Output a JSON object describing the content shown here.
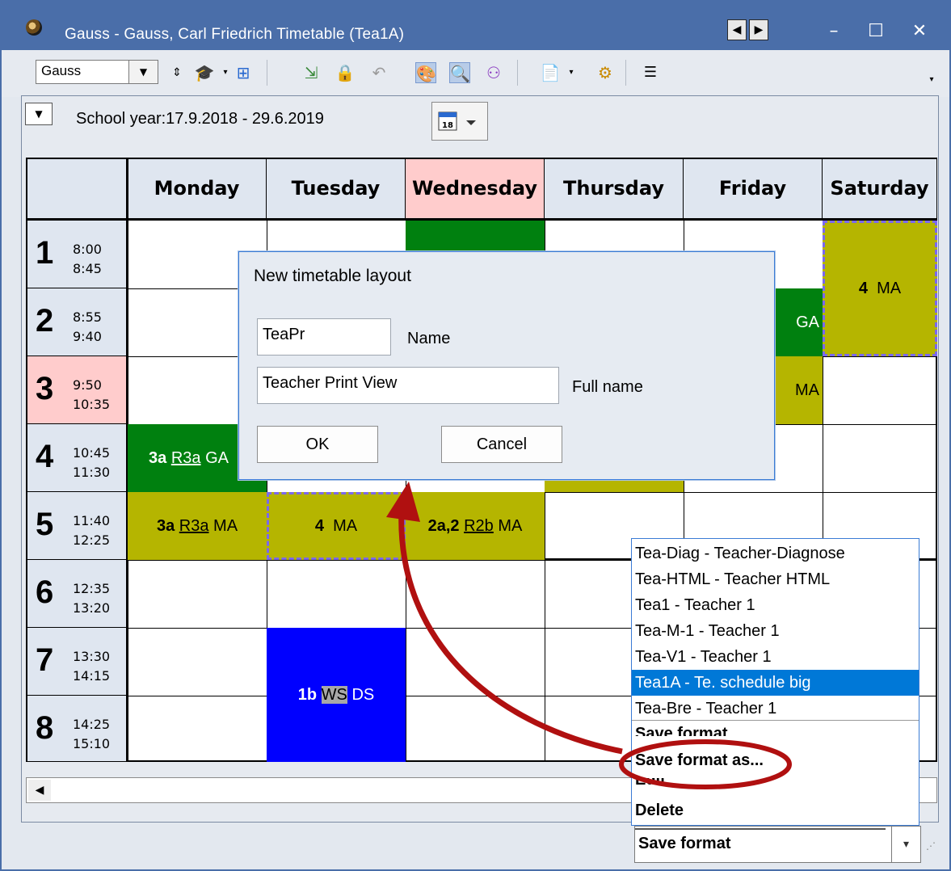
{
  "window": {
    "title": "Gauss - Gauss, Carl Friedrich  Timetable  (Tea1A)",
    "nav_prev": "◀",
    "nav_next": "▶",
    "minimize": "–",
    "maximize": "☐",
    "close": "✕"
  },
  "toolbar": {
    "element_value": "Gauss",
    "icons": [
      "spinner-icon",
      "teacher-cap-icon",
      "grid-icon",
      "export-icon",
      "lock-icon",
      "undo-icon",
      "palette-icon",
      "zoom-icon",
      "people-icon",
      "settings-doc-icon",
      "gear-icon",
      "list-options-icon"
    ]
  },
  "header": {
    "school_year": "School year:17.9.2018 - 29.6.2019",
    "calendar_day": "18"
  },
  "timetable": {
    "days": [
      "Monday",
      "Tuesday",
      "Wednesday",
      "Thursday",
      "Friday",
      "Saturday"
    ],
    "highlighted_day": "Wednesday",
    "highlighted_period": "3",
    "periods": [
      {
        "num": "1",
        "start": "8:00",
        "end": "8:45"
      },
      {
        "num": "2",
        "start": "8:55",
        "end": "9:40"
      },
      {
        "num": "3",
        "start": "9:50",
        "end": "10:35"
      },
      {
        "num": "4",
        "start": "10:45",
        "end": "11:30"
      },
      {
        "num": "5",
        "start": "11:40",
        "end": "12:25"
      },
      {
        "num": "6",
        "start": "12:35",
        "end": "13:20"
      },
      {
        "num": "7",
        "start": "13:30",
        "end": "14:15"
      },
      {
        "num": "8",
        "start": "14:25",
        "end": "15:10"
      }
    ],
    "lessons": {
      "sat_p1": {
        "cls": "4",
        "subj": "MA"
      },
      "fri_p2": {
        "subj": "GA"
      },
      "fri_p3": {
        "subj": "MA"
      },
      "mon_p4": {
        "cls": "3a",
        "room": "R3a",
        "subj": "GA"
      },
      "mon_p5": {
        "cls": "3a",
        "room": "R3a",
        "subj": "MA"
      },
      "tue_p5": {
        "cls": "4",
        "subj": "MA"
      },
      "wed_p5": {
        "cls": "2a,2",
        "room": "R2b",
        "subj": "MA"
      },
      "tue_p7": {
        "cls": "1b",
        "room": "WS",
        "subj": "DS"
      }
    },
    "colors": {
      "olive": "#b5b500",
      "green": "#00800f",
      "blue": "#0000ff",
      "highlight": "#ffcccc"
    }
  },
  "dialog": {
    "title": "New timetable layout",
    "name_value": "TeaPr",
    "name_label": "Name",
    "fullname_value": "Teacher Print View",
    "fullname_label": "Full name",
    "ok": "OK",
    "cancel": "Cancel"
  },
  "format_menu": {
    "items": [
      "Tea-Diag - Teacher-Diagnose",
      "Tea-HTML - Teacher HTML",
      "Tea1 - Teacher 1",
      "Tea-M-1 - Teacher 1",
      "Tea-V1 - Teacher 1",
      "Tea1A - Te. schedule big",
      "Tea-Bre - Teacher 1"
    ],
    "selected": "Tea1A - Te. schedule big",
    "actions": [
      "Save format",
      "Save format as...",
      "Edit",
      "Delete"
    ],
    "current_value": "Save format"
  },
  "annotation_color": "#b01010"
}
